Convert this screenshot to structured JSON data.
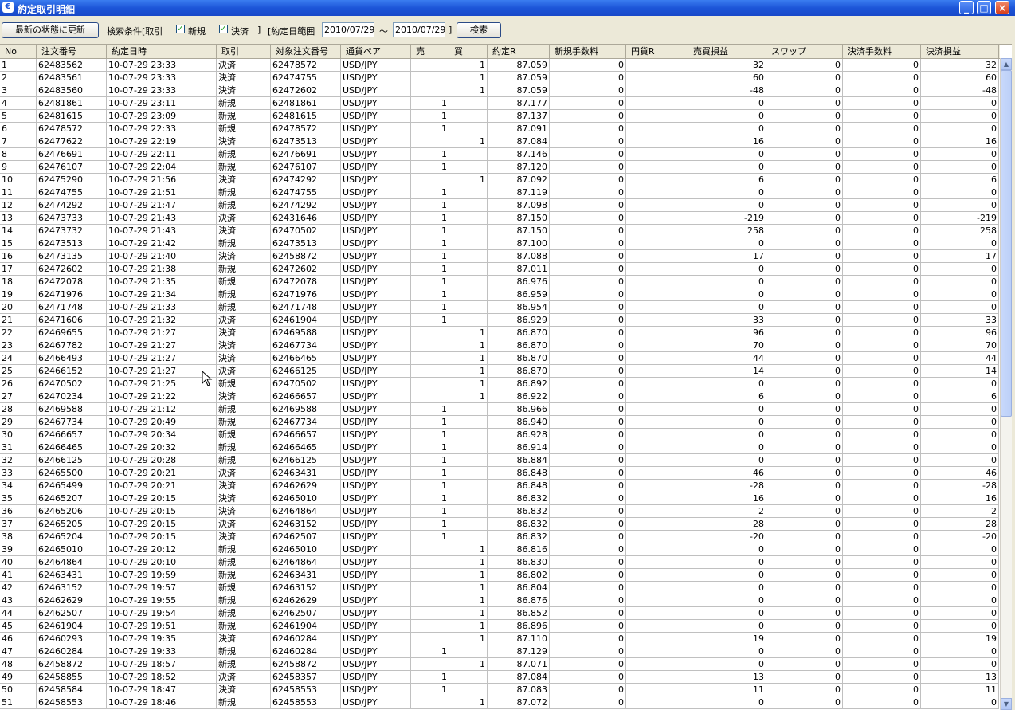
{
  "window": {
    "title": "約定取引明細",
    "icon": "app-icon",
    "minimize": "_",
    "maximize": "□",
    "close": "×"
  },
  "toolbar": {
    "refresh_label": "最新の状態に更新",
    "filter_label": "検索条件[取引",
    "check_new_label": "新規",
    "check_close_label": "決済",
    "bracket_close": "]",
    "date_range_label": "[約定日範囲",
    "date_from": "2010/07/29",
    "tilde": "〜",
    "date_to": "2010/07/29",
    "bracket_close2": "]",
    "search_label": "検索"
  },
  "table": {
    "columns": [
      "No",
      "注文番号",
      "約定日時",
      "取引",
      "対象注文番号",
      "通貨ペア",
      "売",
      "買",
      "約定R",
      "新規手数料",
      "円貨R",
      "売買損益",
      "スワップ",
      "決済手数料",
      "決済損益"
    ],
    "rows": [
      [
        "1",
        "62483562",
        "10-07-29 23:33",
        "決済",
        "62478572",
        "USD/JPY",
        "",
        "1",
        "87.059",
        "0",
        "",
        "32",
        "0",
        "0",
        "32"
      ],
      [
        "2",
        "62483561",
        "10-07-29 23:33",
        "決済",
        "62474755",
        "USD/JPY",
        "",
        "1",
        "87.059",
        "0",
        "",
        "60",
        "0",
        "0",
        "60"
      ],
      [
        "3",
        "62483560",
        "10-07-29 23:33",
        "決済",
        "62472602",
        "USD/JPY",
        "",
        "1",
        "87.059",
        "0",
        "",
        "-48",
        "0",
        "0",
        "-48"
      ],
      [
        "4",
        "62481861",
        "10-07-29 23:11",
        "新規",
        "62481861",
        "USD/JPY",
        "1",
        "",
        "87.177",
        "0",
        "",
        "0",
        "0",
        "0",
        "0"
      ],
      [
        "5",
        "62481615",
        "10-07-29 23:09",
        "新規",
        "62481615",
        "USD/JPY",
        "1",
        "",
        "87.137",
        "0",
        "",
        "0",
        "0",
        "0",
        "0"
      ],
      [
        "6",
        "62478572",
        "10-07-29 22:33",
        "新規",
        "62478572",
        "USD/JPY",
        "1",
        "",
        "87.091",
        "0",
        "",
        "0",
        "0",
        "0",
        "0"
      ],
      [
        "7",
        "62477622",
        "10-07-29 22:19",
        "決済",
        "62473513",
        "USD/JPY",
        "",
        "1",
        "87.084",
        "0",
        "",
        "16",
        "0",
        "0",
        "16"
      ],
      [
        "8",
        "62476691",
        "10-07-29 22:11",
        "新規",
        "62476691",
        "USD/JPY",
        "1",
        "",
        "87.146",
        "0",
        "",
        "0",
        "0",
        "0",
        "0"
      ],
      [
        "9",
        "62476107",
        "10-07-29 22:04",
        "新規",
        "62476107",
        "USD/JPY",
        "1",
        "",
        "87.120",
        "0",
        "",
        "0",
        "0",
        "0",
        "0"
      ],
      [
        "10",
        "62475290",
        "10-07-29 21:56",
        "決済",
        "62474292",
        "USD/JPY",
        "",
        "1",
        "87.092",
        "0",
        "",
        "6",
        "0",
        "0",
        "6"
      ],
      [
        "11",
        "62474755",
        "10-07-29 21:51",
        "新規",
        "62474755",
        "USD/JPY",
        "1",
        "",
        "87.119",
        "0",
        "",
        "0",
        "0",
        "0",
        "0"
      ],
      [
        "12",
        "62474292",
        "10-07-29 21:47",
        "新規",
        "62474292",
        "USD/JPY",
        "1",
        "",
        "87.098",
        "0",
        "",
        "0",
        "0",
        "0",
        "0"
      ],
      [
        "13",
        "62473733",
        "10-07-29 21:43",
        "決済",
        "62431646",
        "USD/JPY",
        "1",
        "",
        "87.150",
        "0",
        "",
        "-219",
        "0",
        "0",
        "-219"
      ],
      [
        "14",
        "62473732",
        "10-07-29 21:43",
        "決済",
        "62470502",
        "USD/JPY",
        "1",
        "",
        "87.150",
        "0",
        "",
        "258",
        "0",
        "0",
        "258"
      ],
      [
        "15",
        "62473513",
        "10-07-29 21:42",
        "新規",
        "62473513",
        "USD/JPY",
        "1",
        "",
        "87.100",
        "0",
        "",
        "0",
        "0",
        "0",
        "0"
      ],
      [
        "16",
        "62473135",
        "10-07-29 21:40",
        "決済",
        "62458872",
        "USD/JPY",
        "1",
        "",
        "87.088",
        "0",
        "",
        "17",
        "0",
        "0",
        "17"
      ],
      [
        "17",
        "62472602",
        "10-07-29 21:38",
        "新規",
        "62472602",
        "USD/JPY",
        "1",
        "",
        "87.011",
        "0",
        "",
        "0",
        "0",
        "0",
        "0"
      ],
      [
        "18",
        "62472078",
        "10-07-29 21:35",
        "新規",
        "62472078",
        "USD/JPY",
        "1",
        "",
        "86.976",
        "0",
        "",
        "0",
        "0",
        "0",
        "0"
      ],
      [
        "19",
        "62471976",
        "10-07-29 21:34",
        "新規",
        "62471976",
        "USD/JPY",
        "1",
        "",
        "86.959",
        "0",
        "",
        "0",
        "0",
        "0",
        "0"
      ],
      [
        "20",
        "62471748",
        "10-07-29 21:33",
        "新規",
        "62471748",
        "USD/JPY",
        "1",
        "",
        "86.954",
        "0",
        "",
        "0",
        "0",
        "0",
        "0"
      ],
      [
        "21",
        "62471606",
        "10-07-29 21:32",
        "決済",
        "62461904",
        "USD/JPY",
        "1",
        "",
        "86.929",
        "0",
        "",
        "33",
        "0",
        "0",
        "33"
      ],
      [
        "22",
        "62469655",
        "10-07-29 21:27",
        "決済",
        "62469588",
        "USD/JPY",
        "",
        "1",
        "86.870",
        "0",
        "",
        "96",
        "0",
        "0",
        "96"
      ],
      [
        "23",
        "62467782",
        "10-07-29 21:27",
        "決済",
        "62467734",
        "USD/JPY",
        "",
        "1",
        "86.870",
        "0",
        "",
        "70",
        "0",
        "0",
        "70"
      ],
      [
        "24",
        "62466493",
        "10-07-29 21:27",
        "決済",
        "62466465",
        "USD/JPY",
        "",
        "1",
        "86.870",
        "0",
        "",
        "44",
        "0",
        "0",
        "44"
      ],
      [
        "25",
        "62466152",
        "10-07-29 21:27",
        "決済",
        "62466125",
        "USD/JPY",
        "",
        "1",
        "86.870",
        "0",
        "",
        "14",
        "0",
        "0",
        "14"
      ],
      [
        "26",
        "62470502",
        "10-07-29 21:25",
        "新規",
        "62470502",
        "USD/JPY",
        "",
        "1",
        "86.892",
        "0",
        "",
        "0",
        "0",
        "0",
        "0"
      ],
      [
        "27",
        "62470234",
        "10-07-29 21:22",
        "決済",
        "62466657",
        "USD/JPY",
        "",
        "1",
        "86.922",
        "0",
        "",
        "6",
        "0",
        "0",
        "6"
      ],
      [
        "28",
        "62469588",
        "10-07-29 21:12",
        "新規",
        "62469588",
        "USD/JPY",
        "1",
        "",
        "86.966",
        "0",
        "",
        "0",
        "0",
        "0",
        "0"
      ],
      [
        "29",
        "62467734",
        "10-07-29 20:49",
        "新規",
        "62467734",
        "USD/JPY",
        "1",
        "",
        "86.940",
        "0",
        "",
        "0",
        "0",
        "0",
        "0"
      ],
      [
        "30",
        "62466657",
        "10-07-29 20:34",
        "新規",
        "62466657",
        "USD/JPY",
        "1",
        "",
        "86.928",
        "0",
        "",
        "0",
        "0",
        "0",
        "0"
      ],
      [
        "31",
        "62466465",
        "10-07-29 20:32",
        "新規",
        "62466465",
        "USD/JPY",
        "1",
        "",
        "86.914",
        "0",
        "",
        "0",
        "0",
        "0",
        "0"
      ],
      [
        "32",
        "62466125",
        "10-07-29 20:28",
        "新規",
        "62466125",
        "USD/JPY",
        "1",
        "",
        "86.884",
        "0",
        "",
        "0",
        "0",
        "0",
        "0"
      ],
      [
        "33",
        "62465500",
        "10-07-29 20:21",
        "決済",
        "62463431",
        "USD/JPY",
        "1",
        "",
        "86.848",
        "0",
        "",
        "46",
        "0",
        "0",
        "46"
      ],
      [
        "34",
        "62465499",
        "10-07-29 20:21",
        "決済",
        "62462629",
        "USD/JPY",
        "1",
        "",
        "86.848",
        "0",
        "",
        "-28",
        "0",
        "0",
        "-28"
      ],
      [
        "35",
        "62465207",
        "10-07-29 20:15",
        "決済",
        "62465010",
        "USD/JPY",
        "1",
        "",
        "86.832",
        "0",
        "",
        "16",
        "0",
        "0",
        "16"
      ],
      [
        "36",
        "62465206",
        "10-07-29 20:15",
        "決済",
        "62464864",
        "USD/JPY",
        "1",
        "",
        "86.832",
        "0",
        "",
        "2",
        "0",
        "0",
        "2"
      ],
      [
        "37",
        "62465205",
        "10-07-29 20:15",
        "決済",
        "62463152",
        "USD/JPY",
        "1",
        "",
        "86.832",
        "0",
        "",
        "28",
        "0",
        "0",
        "28"
      ],
      [
        "38",
        "62465204",
        "10-07-29 20:15",
        "決済",
        "62462507",
        "USD/JPY",
        "1",
        "",
        "86.832",
        "0",
        "",
        "-20",
        "0",
        "0",
        "-20"
      ],
      [
        "39",
        "62465010",
        "10-07-29 20:12",
        "新規",
        "62465010",
        "USD/JPY",
        "",
        "1",
        "86.816",
        "0",
        "",
        "0",
        "0",
        "0",
        "0"
      ],
      [
        "40",
        "62464864",
        "10-07-29 20:10",
        "新規",
        "62464864",
        "USD/JPY",
        "",
        "1",
        "86.830",
        "0",
        "",
        "0",
        "0",
        "0",
        "0"
      ],
      [
        "41",
        "62463431",
        "10-07-29 19:59",
        "新規",
        "62463431",
        "USD/JPY",
        "",
        "1",
        "86.802",
        "0",
        "",
        "0",
        "0",
        "0",
        "0"
      ],
      [
        "42",
        "62463152",
        "10-07-29 19:57",
        "新規",
        "62463152",
        "USD/JPY",
        "",
        "1",
        "86.804",
        "0",
        "",
        "0",
        "0",
        "0",
        "0"
      ],
      [
        "43",
        "62462629",
        "10-07-29 19:55",
        "新規",
        "62462629",
        "USD/JPY",
        "",
        "1",
        "86.876",
        "0",
        "",
        "0",
        "0",
        "0",
        "0"
      ],
      [
        "44",
        "62462507",
        "10-07-29 19:54",
        "新規",
        "62462507",
        "USD/JPY",
        "",
        "1",
        "86.852",
        "0",
        "",
        "0",
        "0",
        "0",
        "0"
      ],
      [
        "45",
        "62461904",
        "10-07-29 19:51",
        "新規",
        "62461904",
        "USD/JPY",
        "",
        "1",
        "86.896",
        "0",
        "",
        "0",
        "0",
        "0",
        "0"
      ],
      [
        "46",
        "62460293",
        "10-07-29 19:35",
        "決済",
        "62460284",
        "USD/JPY",
        "",
        "1",
        "87.110",
        "0",
        "",
        "19",
        "0",
        "0",
        "19"
      ],
      [
        "47",
        "62460284",
        "10-07-29 19:33",
        "新規",
        "62460284",
        "USD/JPY",
        "1",
        "",
        "87.129",
        "0",
        "",
        "0",
        "0",
        "0",
        "0"
      ],
      [
        "48",
        "62458872",
        "10-07-29 18:57",
        "新規",
        "62458872",
        "USD/JPY",
        "",
        "1",
        "87.071",
        "0",
        "",
        "0",
        "0",
        "0",
        "0"
      ],
      [
        "49",
        "62458855",
        "10-07-29 18:52",
        "決済",
        "62458357",
        "USD/JPY",
        "1",
        "",
        "87.084",
        "0",
        "",
        "13",
        "0",
        "0",
        "13"
      ],
      [
        "50",
        "62458584",
        "10-07-29 18:47",
        "決済",
        "62458553",
        "USD/JPY",
        "1",
        "",
        "87.083",
        "0",
        "",
        "11",
        "0",
        "0",
        "11"
      ],
      [
        "51",
        "62458553",
        "10-07-29 18:46",
        "新規",
        "62458553",
        "USD/JPY",
        "",
        "1",
        "87.072",
        "0",
        "",
        "0",
        "0",
        "0",
        "0"
      ]
    ]
  },
  "scrollbar": {
    "up": "▲",
    "down": "▼"
  },
  "colors": {
    "titlebar": "#1c55d8",
    "chrome": "#ece9d8",
    "grid_line": "#c0c0c0"
  }
}
